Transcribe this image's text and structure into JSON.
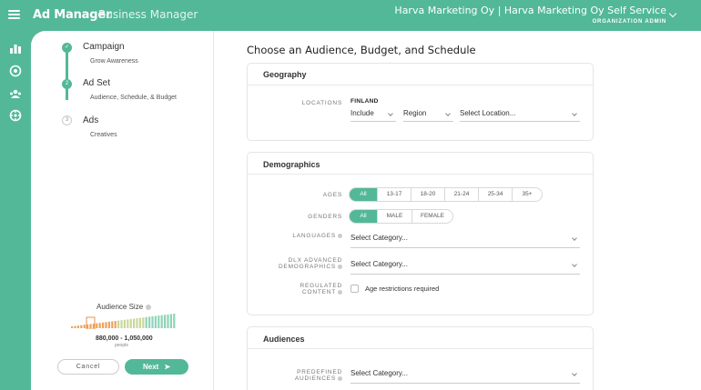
{
  "topbar": {
    "brand": "Ad Manager",
    "business_manager": "Business Manager",
    "org_name": "Harva Marketing Oy  |  Harva Marketing Oy Self Service",
    "org_role": "ORGANIZATION ADMIN"
  },
  "rail": {
    "icons": [
      "bar-chart-icon",
      "campaign-icon",
      "audience-icon",
      "settings-icon"
    ]
  },
  "steps": {
    "items": [
      {
        "title": "Campaign",
        "subtitle": "Grow Awareness",
        "marker": "✓",
        "state": "done"
      },
      {
        "title": "Ad Set",
        "subtitle": "Audience, Schedule, & Budget",
        "marker": "2",
        "state": "current"
      },
      {
        "title": "Ads",
        "subtitle": "Creatives",
        "marker": "3",
        "state": "todo"
      }
    ]
  },
  "audience": {
    "title": "Audience Size",
    "range": "880,000 - 1,050,000",
    "unit": "people"
  },
  "actions": {
    "cancel": "Cancel",
    "next": "Next"
  },
  "main": {
    "title": "Choose an Audience, Budget, and Schedule"
  },
  "geography": {
    "header": "Geography",
    "locations_label": "LOCATIONS",
    "country": "FINLAND",
    "include": "Include",
    "region": "Region",
    "location_placeholder": "Select Location..."
  },
  "demographics": {
    "header": "Demographics",
    "ages_label": "AGES",
    "ages": [
      "All",
      "13-17",
      "18-20",
      "21-24",
      "25-34",
      "35+"
    ],
    "genders_label": "GENDERS",
    "genders": [
      "All",
      "MALE",
      "FEMALE"
    ],
    "languages_label": "LANGUAGES",
    "languages_placeholder": "Select Category...",
    "dlx_label_1": "DLX ADVANCED",
    "dlx_label_2": "DEMOGRAPHICS",
    "dlx_placeholder": "Select Category...",
    "regulated_label_1": "REGULATED",
    "regulated_label_2": "CONTENT",
    "age_restrictions": "Age restrictions required"
  },
  "audiences": {
    "header": "Audiences",
    "predefined_label_1": "PREDEFINED",
    "predefined_label_2": "AUDIENCES",
    "predefined_placeholder": "Select Category..."
  },
  "colors": {
    "accent": "#52b898",
    "background": "#ffffff"
  }
}
